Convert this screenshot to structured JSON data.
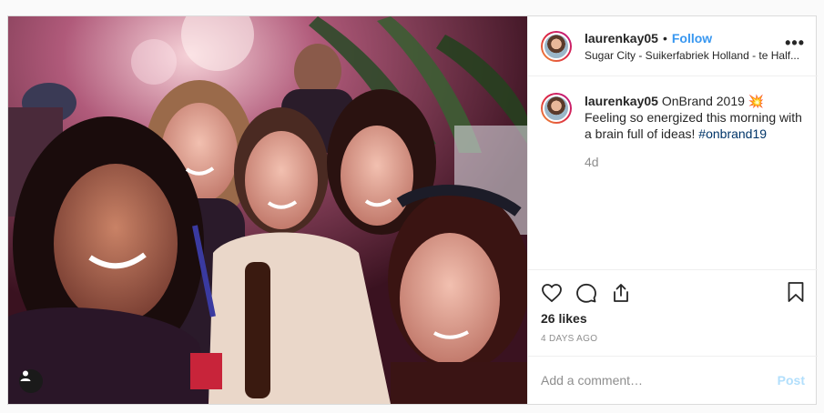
{
  "post": {
    "username": "laurenkay05",
    "separator": "•",
    "follow_label": "Follow",
    "location": "Sugar City - Suikerfabriek Holland - te Half...",
    "more_label": "•••"
  },
  "caption": {
    "username": "laurenkay05",
    "text_start": "OnBrand 2019 ",
    "emoji": "💥",
    "text_rest": "Feeling so energized this morning with a brain full of ideas! ",
    "hashtag": "#onbrand19",
    "age": "4d"
  },
  "actions": {
    "icons": [
      "heart-icon",
      "comment-icon",
      "share-icon",
      "bookmark-icon"
    ]
  },
  "likes_text": "26 likes",
  "timestamp": "4 DAYS AGO",
  "comment_box": {
    "placeholder": "Add a comment…",
    "post_label": "Post"
  },
  "colors": {
    "link_blue": "#3897f0",
    "hashtag_blue": "#003569",
    "muted": "#8e8e8e",
    "post_disabled": "#b2dffc"
  }
}
